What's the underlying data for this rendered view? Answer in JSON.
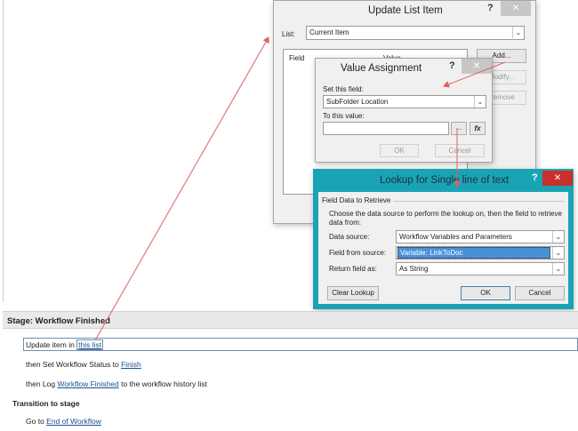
{
  "update_list_item": {
    "title": "Update List Item",
    "help": "?",
    "close": "✕",
    "list_label": "List:",
    "list_value": "Current Item",
    "col_field": "Field",
    "col_value": "Value",
    "add_button": "Add...",
    "modify_button": "Modify...",
    "remove_button": "Remove"
  },
  "value_assignment": {
    "title": "Value Assignment",
    "help": "?",
    "close": "✕",
    "set_field_label": "Set this field:",
    "set_field_value": "SubFolder Location",
    "to_value_label": "To this value:",
    "to_value_value": "",
    "ellipsis_button": "...",
    "fx_button": "fx",
    "ok_button": "OK",
    "cancel_button": "Cancel"
  },
  "lookup": {
    "title": "Lookup for Single line of text",
    "help": "?",
    "close": "✕",
    "section_title": "Field Data to Retrieve",
    "description": "Choose the data source to perform the lookup on, then the field to retrieve data from:",
    "data_source_label": "Data source:",
    "data_source_value": "Workflow Variables and Parameters",
    "field_from_source_label": "Field from source:",
    "field_from_source_value": "Variable: LinkToDoc",
    "return_field_label": "Return field as:",
    "return_field_value": "As String",
    "clear_lookup_button": "Clear Lookup",
    "ok_button": "OK",
    "cancel_button": "Cancel"
  },
  "workflow": {
    "stage_title": "Stage: Workflow Finished",
    "line1_prefix": "Update item in ",
    "line1_link": "this list",
    "line2_prefix": "then Set Workflow Status to ",
    "line2_link": "Finish",
    "line3_prefix": "then Log ",
    "line3_link": "Workflow Finished",
    "line3_suffix": " to the workflow history list",
    "transition_title": "Transition to stage",
    "go_prefix": "Go to ",
    "go_link": "End of Workflow"
  },
  "colors": {
    "annotation": "#e06060",
    "lookup_border": "#1aa3b5",
    "selected": "#4a90d9",
    "close_red": "#c9302c"
  }
}
